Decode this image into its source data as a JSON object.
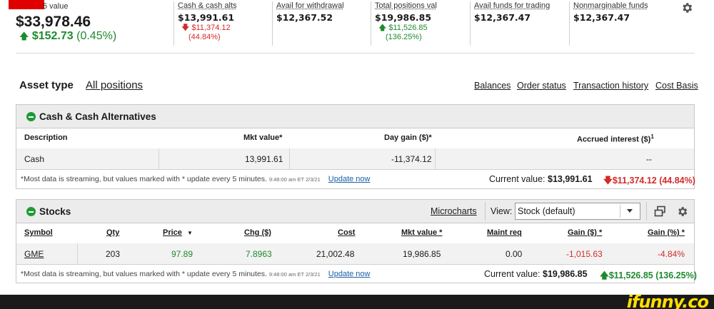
{
  "summary": {
    "account_label": "5 value",
    "total_value": "$33,978.46",
    "day_change_arrow": "🡅",
    "day_change_amount": "$152.73",
    "day_change_pct": "(0.45%)",
    "columns": [
      {
        "label": "Cash & cash alts",
        "value": "$13,991.61",
        "sub1": "🡇 $11,374.12",
        "sub2": "(44.84%)",
        "tone": "red"
      },
      {
        "label": "Avail for withdrawal",
        "value": "$12,367.52",
        "sub1": "",
        "sub2": "",
        "tone": ""
      },
      {
        "label": "Total positions val",
        "value": "$19,986.85",
        "sub1": "🡅 $11,526.85",
        "sub2": "(136.25%)",
        "tone": "green"
      },
      {
        "label": "Avail funds for trading",
        "value": "$12,367.47",
        "sub1": "",
        "sub2": "",
        "tone": ""
      },
      {
        "label": "Nonmarginable funds",
        "value": "$12,367.47",
        "sub1": "",
        "sub2": "",
        "tone": ""
      }
    ]
  },
  "nav": {
    "asset_type": "Asset type",
    "all_positions": "All positions",
    "links": [
      "Balances",
      "Order status",
      "Transaction history",
      "Cost Basis"
    ]
  },
  "cash_panel": {
    "title": "Cash & Cash Alternatives",
    "headers": {
      "description": "Description",
      "mkt_value": "Mkt value*",
      "day_gain": "Day gain ($)*",
      "accrued": "Accrued interest ($)",
      "accrued_sup": "1"
    },
    "row": {
      "description": "Cash",
      "mkt_value": "13,991.61",
      "day_gain": "-11,374.12",
      "accrued": "--"
    },
    "note": "*Most data is streaming, but values marked with * update every 5 minutes.",
    "timestamp": "9:48:00 am ET 2/3/21",
    "update_now": "Update now",
    "current_label": "Current value:",
    "current_value": "$13,991.61",
    "change": "🡇$11,374.12 (44.84%)"
  },
  "stocks_panel": {
    "title": "Stocks",
    "microcharts": "Microcharts",
    "view_label": "View:",
    "view_value": "Stock (default)",
    "headers": {
      "symbol": "Symbol",
      "qty": "Qty",
      "price": "Price",
      "price_sort": "▼",
      "chg": "Chg ($)",
      "cost": "Cost",
      "mkt_value": "Mkt value *",
      "maint_req": "Maint req",
      "gain": "Gain ($) *",
      "gain_pct": "Gain (%) *"
    },
    "row": {
      "symbol": "GME",
      "qty": "203",
      "price": "97.89",
      "chg": "7.8963",
      "cost": "21,002.48",
      "mkt_value": "19,986.85",
      "maint_req": "0.00",
      "gain": "-1,015.63",
      "gain_pct": "-4.84%"
    },
    "note": "*Most data is streaming, but values marked with * update every 5 minutes.",
    "timestamp": "9:48:00 am ET 2/3/21",
    "update_now": "Update now",
    "current_label": "Current value:",
    "current_value": "$19,986.85",
    "change": "🡅$11,526.85 (136.25%)"
  },
  "watermark": "ifunny.co",
  "colors": {
    "gain": "#1e8a2e",
    "loss": "#d32b2b",
    "accent": "#1e9a36",
    "header_bg": "#ececec"
  }
}
